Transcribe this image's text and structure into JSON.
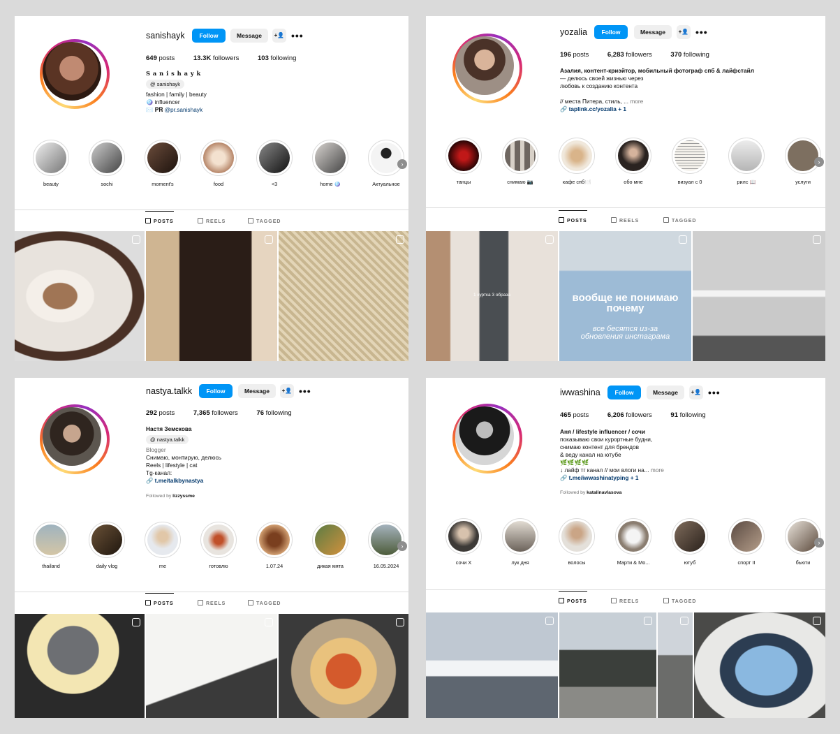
{
  "profiles": [
    {
      "username": "sanishayk",
      "follow_label": "Follow",
      "message_label": "Message",
      "posts": "649",
      "posts_label": "posts",
      "followers": "13.3K",
      "followers_label": "followers",
      "following": "103",
      "following_label": "following",
      "display_name": "S a n i s h a y k",
      "threads": "sanishayk",
      "bio": [
        "fashion | family | beauty",
        "🪩 influencer",
        "✉️ 𝐏𝐑 "
      ],
      "bio_link": "@pr.sanishayk",
      "highlights": [
        "beauty",
        "sochi",
        "moment's",
        "food",
        "<3",
        "home 🪩",
        "Актуальное"
      ],
      "tabs": [
        "POSTS",
        "REELS",
        "TAGGED"
      ]
    },
    {
      "username": "yozalia",
      "follow_label": "Follow",
      "message_label": "Message",
      "posts": "196",
      "posts_label": "posts",
      "followers": "6,283",
      "followers_label": "followers",
      "following": "370",
      "following_label": "following",
      "display_name": "Азалия, контент-криэйтор, мобильный фотограф спб & лайфстайл",
      "bio": [
        "— делюсь своей жизнью через",
        "любовь к созданию контента",
        "",
        "// места Питера, стиль, ... "
      ],
      "bio_more": "more",
      "bio_link": "taplink.cc/yozalia + 1",
      "highlights": [
        "танцы",
        "снимаю 📷",
        "кафе спб🍽️",
        "обо мне",
        "визуал с 0",
        "рилс 📖",
        "услуги"
      ],
      "tabs": [
        "POSTS",
        "REELS",
        "TAGGED"
      ],
      "post_overlay_1": "1 куртка 3 образа",
      "post_overlay_2a": "вообще не понимаю почему",
      "post_overlay_2b": "все бесятся из-за обновления инстаграма"
    },
    {
      "username": "nastya.talkk",
      "follow_label": "Follow",
      "message_label": "Message",
      "posts": "292",
      "posts_label": "posts",
      "followers": "7,365",
      "followers_label": "followers",
      "following": "76",
      "following_label": "following",
      "display_name": "Настя Земскова",
      "threads": "nastya.talkk",
      "category": "Blogger",
      "bio": [
        "Снимаю, монтирую, делюсь",
        "Reels | lifestyle | cat",
        "Tg-канал:"
      ],
      "bio_link": "t.me/talkbynastya",
      "followed_by_label": "Followed by",
      "followed_by": "lizzyssme",
      "highlights": [
        "thailand",
        "daily vlog",
        "me",
        "готовлю",
        "1.07.24",
        "дикая мята",
        "16.05.2024"
      ],
      "tabs": [
        "POSTS",
        "REELS",
        "TAGGED"
      ]
    },
    {
      "username": "iwwashina",
      "follow_label": "Follow",
      "message_label": "Message",
      "posts": "465",
      "posts_label": "posts",
      "followers": "6,206",
      "followers_label": "followers",
      "following": "91",
      "following_label": "following",
      "display_name": "Аня / lifestyle influencer / сочи",
      "bio": [
        "показываю свои курортные будни,",
        "снимаю контент для брендов",
        "& веду канал на ютубе",
        "🌿🌿🌿🌿",
        "↓ лайф тг канал // мои влоги на... "
      ],
      "bio_more": "more",
      "bio_link": "t.me/iwwashinatyping + 1",
      "followed_by_label": "Followed by",
      "followed_by": "katalinavlasova",
      "highlights": [
        "сочи X",
        "лук дня",
        "волосы",
        "Марти & Мо...",
        "ютуб",
        "спорт II",
        "бьюти"
      ],
      "tabs": [
        "POSTS",
        "REELS",
        "TAGGED"
      ]
    }
  ],
  "colors": {
    "follow": "#0095f6",
    "secondary_btn": "#efefef",
    "link": "#00376b",
    "muted": "#737373"
  }
}
